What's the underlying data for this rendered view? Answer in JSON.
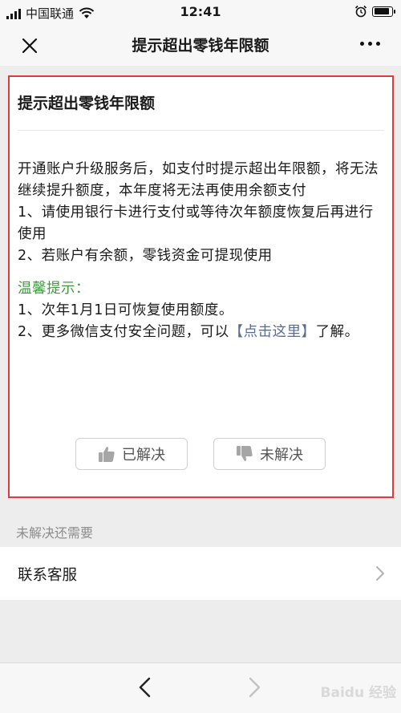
{
  "status_bar": {
    "carrier": "中国联通",
    "time": "12:41",
    "battery_level": 0.9
  },
  "nav": {
    "title": "提示超出零钱年限额"
  },
  "card": {
    "title": "提示超出零钱年限额",
    "paragraphs": [
      "开通账户升级服务后，如支付时提示超出年限额，将无法继续提升额度，本年度将无法再使用余额支付",
      "1、请使用银行卡进行支付或等待次年额度恢复后再进行使用",
      "2、若账户有余额，零钱资金可提现使用"
    ],
    "tips_title": "温馨提示：",
    "tips": {
      "item1": "1、次年1月1日可恢复使用额度。",
      "item2_before": "2、更多微信支付安全问题，可以",
      "item2_link": "【点击这里】",
      "item2_after": "了解。"
    },
    "resolved_label": "已解决",
    "unresolved_label": "未解决"
  },
  "section_label": "未解决还需要",
  "contact_label": "联系客服",
  "watermark": "Baidu 经验",
  "colors": {
    "highlight_border": "#e03a3a",
    "tips_green": "#3d9a3d",
    "link_blue": "#576b95"
  }
}
